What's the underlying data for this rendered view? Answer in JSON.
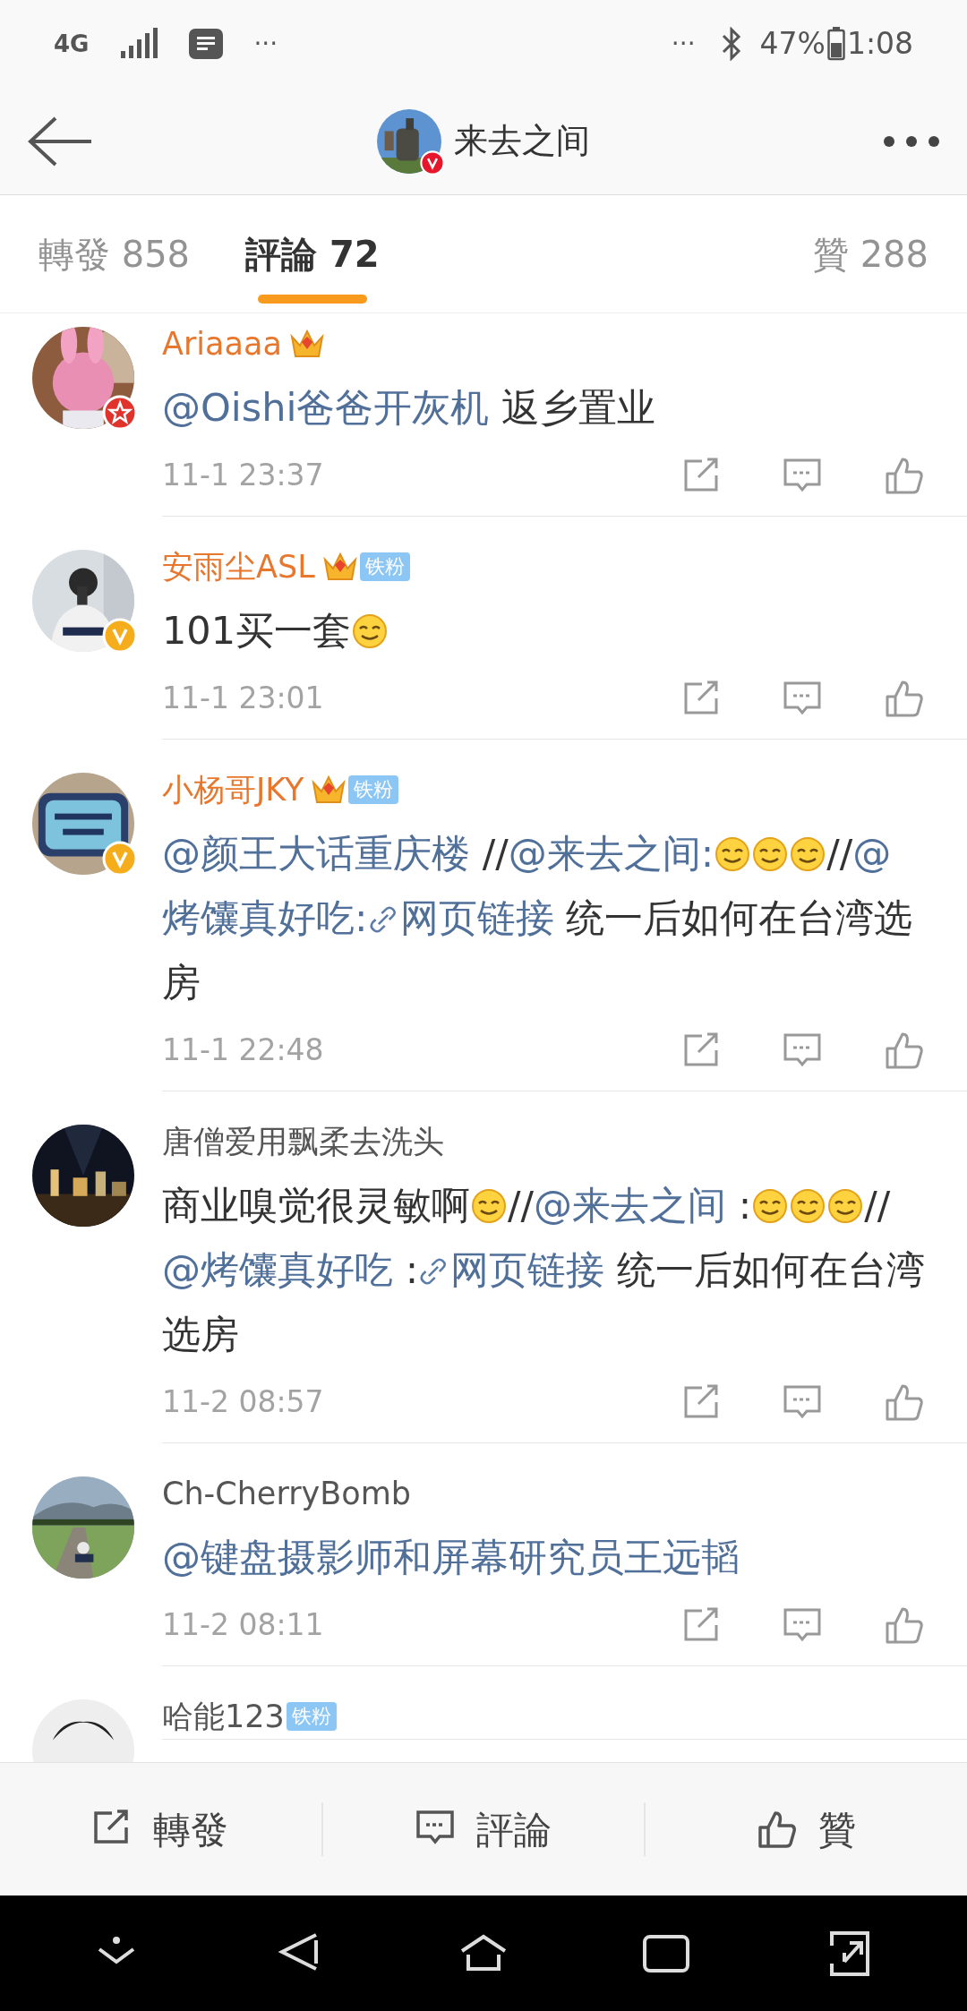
{
  "status_bar": {
    "network": "4G",
    "left_more": "···",
    "right_more": "···",
    "battery": "47%",
    "time": "1:08"
  },
  "header": {
    "title": "来去之间",
    "verified_badge": {
      "kind": "red"
    }
  },
  "tabs": [
    {
      "label": "轉發 858",
      "selected": false
    },
    {
      "label": "評論 72",
      "selected": true
    },
    {
      "label": "贊 288",
      "selected": false
    }
  ],
  "comments": [
    {
      "name": "Ariaaaa",
      "vip": true,
      "crown": true,
      "verified_badge": {
        "kind": "star"
      },
      "time": "11-1 23:37",
      "body": [
        {
          "kind": "link",
          "text": "@Oishi爸爸开灰机"
        },
        {
          "kind": "text",
          "text": " 返乡置业"
        }
      ]
    },
    {
      "name": "安雨尘ASL",
      "vip": true,
      "crown": true,
      "fan_badge": "铁粉",
      "verified_badge": {
        "kind": "gold"
      },
      "time": "11-1 23:01",
      "body": [
        {
          "kind": "text",
          "text": "101买一套"
        },
        {
          "kind": "emoji"
        }
      ]
    },
    {
      "name": "小杨哥JKY",
      "vip": true,
      "crown": true,
      "fan_badge": "铁粉",
      "verified_badge": {
        "kind": "gold"
      },
      "time": "11-1 22:48",
      "body": [
        {
          "kind": "link",
          "text": "@颜王大话重庆楼"
        },
        {
          "kind": "text",
          "text": " //"
        },
        {
          "kind": "link",
          "text": "@来去之间:"
        },
        {
          "kind": "emoji"
        },
        {
          "kind": "emoji"
        },
        {
          "kind": "emoji"
        },
        {
          "kind": "text",
          "text": "//"
        },
        {
          "kind": "link",
          "text": "@"
        },
        {
          "kind": "link",
          "text": "烤馕真好吃:"
        },
        {
          "kind": "weblink",
          "text": "网页链接"
        },
        {
          "kind": "text",
          "text": "  统一后如何在台湾选房"
        }
      ]
    },
    {
      "name": "唐僧爱用飘柔去洗头",
      "vip": false,
      "crown": false,
      "time": "11-2 08:57",
      "body": [
        {
          "kind": "text",
          "text": "商业嗅觉很灵敏啊"
        },
        {
          "kind": "emoji"
        },
        {
          "kind": "text",
          "text": "//"
        },
        {
          "kind": "link",
          "text": "@来去之间"
        },
        {
          "kind": "text",
          "text": " :"
        },
        {
          "kind": "emoji"
        },
        {
          "kind": "emoji"
        },
        {
          "kind": "emoji"
        },
        {
          "kind": "text",
          "text": "//"
        },
        {
          "kind": "link",
          "text": "@烤馕真好吃"
        },
        {
          "kind": "text",
          "text": " :"
        },
        {
          "kind": "weblink",
          "text": "网页链接"
        },
        {
          "kind": "text",
          "text": "  统一后如何在台湾选房"
        }
      ]
    },
    {
      "name": "Ch-CherryBomb",
      "vip": false,
      "crown": false,
      "time": "11-2 08:11",
      "body": [
        {
          "kind": "link",
          "text": "@键盘摄影师和屏幕研究员王远韬"
        }
      ]
    },
    {
      "name": "哈能123",
      "vip": false,
      "crown": false,
      "fan_badge": "铁粉"
    }
  ],
  "actions": [
    {
      "kind": "share",
      "label": "轉發"
    },
    {
      "kind": "comment",
      "label": "評論"
    },
    {
      "kind": "like",
      "label": "贊"
    }
  ]
}
